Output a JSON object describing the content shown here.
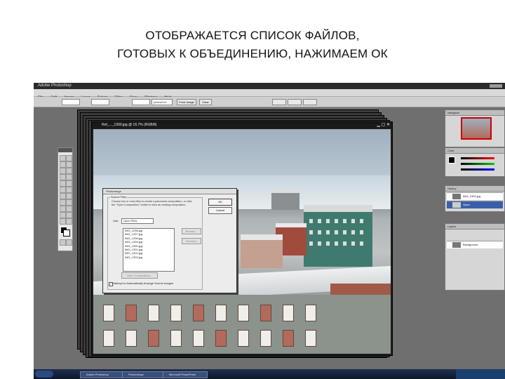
{
  "slide": {
    "title_line1": "ОТОБРАЖАЕТСЯ СПИСОК ФАЙЛОВ,",
    "title_line2": "ГОТОВЫХ К ОБЪЕДИНЕНИЮ, НАЖИМАЕМ ОК"
  },
  "app": {
    "window_title": "Adobe Photoshop",
    "menu": [
      "File",
      "Edit",
      "Image",
      "Layer",
      "Select",
      "Filter",
      "View",
      "Window",
      "Help"
    ]
  },
  "options_bar": {
    "resolution_value": "pixels/inch",
    "front_image_label": "Front Image",
    "clear_label": "Clear"
  },
  "document": {
    "title": "Ref_..._1300.jpg @ 16.7% (RGB/8)"
  },
  "dialog": {
    "title": "Photomerge",
    "group_title": "Source Files",
    "description": "Choose two or more files to create a panorama composition, or click the \"Open Composition\" button to view an existing composition.",
    "use_label": "Use:",
    "use_value": "Open Files",
    "files": [
      "IMG_1296.jpg",
      "IMG_1297.jpg",
      "IMG_1298.jpg",
      "IMG_1299.jpg",
      "IMG_1300.jpg",
      "IMG_1301.jpg",
      "IMG_1302.jpg",
      "IMG_1303.jpg"
    ],
    "browse_label": "Browse...",
    "remove_label": "Remove",
    "open_composition_label": "Open Composition...",
    "ok_label": "OK",
    "cancel_label": "Cancel",
    "checkbox_label": "Attempt to Automatically Arrange Source Images",
    "checkbox_checked": true
  },
  "palettes": {
    "navigator_tab": "Navigator",
    "color_tab": "Color",
    "history_tab": "History",
    "layers_tab": "Layers",
    "history_row": "IMG_1300.jpg",
    "history_row2": "Open",
    "layer_row": "Background"
  },
  "taskbar": {
    "tasks": [
      "Adobe Photoshop",
      "Photomerge",
      "Microsoft PowerPoint"
    ]
  }
}
